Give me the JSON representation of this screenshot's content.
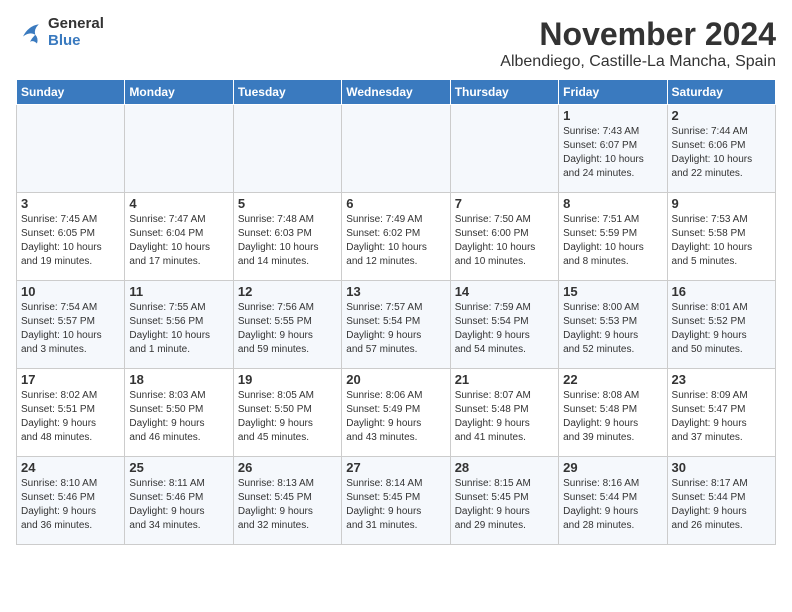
{
  "logo": {
    "line1": "General",
    "line2": "Blue"
  },
  "title": "November 2024",
  "location": "Albendiego, Castille-La Mancha, Spain",
  "days_of_week": [
    "Sunday",
    "Monday",
    "Tuesday",
    "Wednesday",
    "Thursday",
    "Friday",
    "Saturday"
  ],
  "weeks": [
    [
      {
        "day": "",
        "info": ""
      },
      {
        "day": "",
        "info": ""
      },
      {
        "day": "",
        "info": ""
      },
      {
        "day": "",
        "info": ""
      },
      {
        "day": "",
        "info": ""
      },
      {
        "day": "1",
        "info": "Sunrise: 7:43 AM\nSunset: 6:07 PM\nDaylight: 10 hours\nand 24 minutes."
      },
      {
        "day": "2",
        "info": "Sunrise: 7:44 AM\nSunset: 6:06 PM\nDaylight: 10 hours\nand 22 minutes."
      }
    ],
    [
      {
        "day": "3",
        "info": "Sunrise: 7:45 AM\nSunset: 6:05 PM\nDaylight: 10 hours\nand 19 minutes."
      },
      {
        "day": "4",
        "info": "Sunrise: 7:47 AM\nSunset: 6:04 PM\nDaylight: 10 hours\nand 17 minutes."
      },
      {
        "day": "5",
        "info": "Sunrise: 7:48 AM\nSunset: 6:03 PM\nDaylight: 10 hours\nand 14 minutes."
      },
      {
        "day": "6",
        "info": "Sunrise: 7:49 AM\nSunset: 6:02 PM\nDaylight: 10 hours\nand 12 minutes."
      },
      {
        "day": "7",
        "info": "Sunrise: 7:50 AM\nSunset: 6:00 PM\nDaylight: 10 hours\nand 10 minutes."
      },
      {
        "day": "8",
        "info": "Sunrise: 7:51 AM\nSunset: 5:59 PM\nDaylight: 10 hours\nand 8 minutes."
      },
      {
        "day": "9",
        "info": "Sunrise: 7:53 AM\nSunset: 5:58 PM\nDaylight: 10 hours\nand 5 minutes."
      }
    ],
    [
      {
        "day": "10",
        "info": "Sunrise: 7:54 AM\nSunset: 5:57 PM\nDaylight: 10 hours\nand 3 minutes."
      },
      {
        "day": "11",
        "info": "Sunrise: 7:55 AM\nSunset: 5:56 PM\nDaylight: 10 hours\nand 1 minute."
      },
      {
        "day": "12",
        "info": "Sunrise: 7:56 AM\nSunset: 5:55 PM\nDaylight: 9 hours\nand 59 minutes."
      },
      {
        "day": "13",
        "info": "Sunrise: 7:57 AM\nSunset: 5:54 PM\nDaylight: 9 hours\nand 57 minutes."
      },
      {
        "day": "14",
        "info": "Sunrise: 7:59 AM\nSunset: 5:54 PM\nDaylight: 9 hours\nand 54 minutes."
      },
      {
        "day": "15",
        "info": "Sunrise: 8:00 AM\nSunset: 5:53 PM\nDaylight: 9 hours\nand 52 minutes."
      },
      {
        "day": "16",
        "info": "Sunrise: 8:01 AM\nSunset: 5:52 PM\nDaylight: 9 hours\nand 50 minutes."
      }
    ],
    [
      {
        "day": "17",
        "info": "Sunrise: 8:02 AM\nSunset: 5:51 PM\nDaylight: 9 hours\nand 48 minutes."
      },
      {
        "day": "18",
        "info": "Sunrise: 8:03 AM\nSunset: 5:50 PM\nDaylight: 9 hours\nand 46 minutes."
      },
      {
        "day": "19",
        "info": "Sunrise: 8:05 AM\nSunset: 5:50 PM\nDaylight: 9 hours\nand 45 minutes."
      },
      {
        "day": "20",
        "info": "Sunrise: 8:06 AM\nSunset: 5:49 PM\nDaylight: 9 hours\nand 43 minutes."
      },
      {
        "day": "21",
        "info": "Sunrise: 8:07 AM\nSunset: 5:48 PM\nDaylight: 9 hours\nand 41 minutes."
      },
      {
        "day": "22",
        "info": "Sunrise: 8:08 AM\nSunset: 5:48 PM\nDaylight: 9 hours\nand 39 minutes."
      },
      {
        "day": "23",
        "info": "Sunrise: 8:09 AM\nSunset: 5:47 PM\nDaylight: 9 hours\nand 37 minutes."
      }
    ],
    [
      {
        "day": "24",
        "info": "Sunrise: 8:10 AM\nSunset: 5:46 PM\nDaylight: 9 hours\nand 36 minutes."
      },
      {
        "day": "25",
        "info": "Sunrise: 8:11 AM\nSunset: 5:46 PM\nDaylight: 9 hours\nand 34 minutes."
      },
      {
        "day": "26",
        "info": "Sunrise: 8:13 AM\nSunset: 5:45 PM\nDaylight: 9 hours\nand 32 minutes."
      },
      {
        "day": "27",
        "info": "Sunrise: 8:14 AM\nSunset: 5:45 PM\nDaylight: 9 hours\nand 31 minutes."
      },
      {
        "day": "28",
        "info": "Sunrise: 8:15 AM\nSunset: 5:45 PM\nDaylight: 9 hours\nand 29 minutes."
      },
      {
        "day": "29",
        "info": "Sunrise: 8:16 AM\nSunset: 5:44 PM\nDaylight: 9 hours\nand 28 minutes."
      },
      {
        "day": "30",
        "info": "Sunrise: 8:17 AM\nSunset: 5:44 PM\nDaylight: 9 hours\nand 26 minutes."
      }
    ]
  ]
}
